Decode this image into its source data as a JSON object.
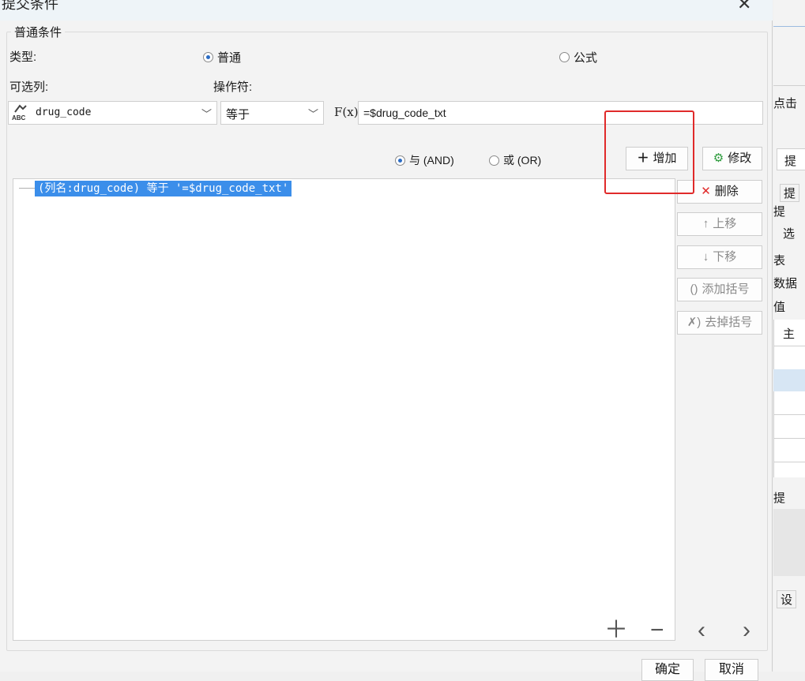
{
  "dialog": {
    "title": "提交条件",
    "group_title": "普通条件",
    "type_label": "类型:",
    "type_options": [
      {
        "label": "普通",
        "checked": true
      },
      {
        "label": "公式",
        "checked": false
      }
    ],
    "column_label": "可选列:",
    "operator_label": "操作符:",
    "column_value": "drug_code",
    "operator_value": "等于",
    "fx_label": "F(x)",
    "formula_value": "=$drug_code_txt",
    "logic_options": [
      {
        "label": "与 (AND)",
        "checked": true
      },
      {
        "label": "或 (OR)",
        "checked": false
      }
    ],
    "buttons": {
      "add": "增加",
      "modify": "修改",
      "delete": "删除",
      "move_up": "上移",
      "move_down": "下移",
      "add_bracket": "添加括号",
      "remove_bracket": "去掉括号"
    },
    "condition_item": "(列名:drug_code) 等于 '=$drug_code_txt'",
    "footer": {
      "ok": "确定",
      "cancel": "取消"
    }
  },
  "right_panel": {
    "texts": [
      "点击",
      "提",
      "提",
      "提",
      "选",
      "表",
      "数据",
      "值",
      "主",
      "提",
      "设"
    ]
  },
  "colors": {
    "accent": "#3b8eea",
    "highlight": "#e02a2a"
  }
}
